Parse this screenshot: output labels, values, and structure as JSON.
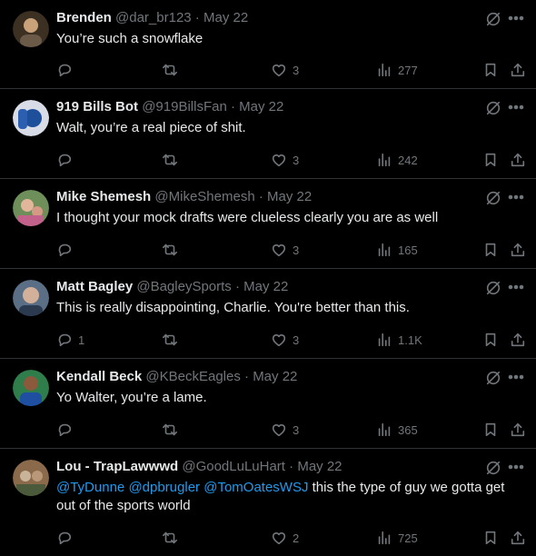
{
  "tweets": [
    {
      "name": "Brenden",
      "handle": "@dar_br123",
      "date": "May 22",
      "text": "You’re such a snowflake",
      "replies": "",
      "likes": "3",
      "views": "277",
      "avatar_colors": [
        "#3b3022",
        "#c9a27a"
      ]
    },
    {
      "name": "919 Bills Bot",
      "handle": "@919BillsFan",
      "date": "May 22",
      "text": "Walt, you’re a real piece of shit.",
      "replies": "",
      "likes": "3",
      "views": "242",
      "avatar_colors": [
        "#1d4f9a",
        "#d8dce6"
      ]
    },
    {
      "name": "Mike Shemesh",
      "handle": "@MikeShemesh",
      "date": "May 22",
      "text": "I thought your mock drafts  were clueless clearly you are as well",
      "replies": "",
      "likes": "3",
      "views": "165",
      "avatar_colors": [
        "#6f8f5a",
        "#e2b69a"
      ]
    },
    {
      "name": "Matt Bagley",
      "handle": "@BagleySports",
      "date": "May 22",
      "text": "This is really disappointing, Charlie. You're better than this.",
      "replies": "1",
      "likes": "3",
      "views": "1.1K",
      "avatar_colors": [
        "#5a6f86",
        "#d3b09a"
      ]
    },
    {
      "name": "Kendall Beck",
      "handle": "@KBeckEagles",
      "date": "May 22",
      "text": "Yo Walter, you’re a lame.",
      "replies": "",
      "likes": "3",
      "views": "365",
      "avatar_colors": [
        "#2e7d4a",
        "#8b5a3c"
      ]
    },
    {
      "name": "Lou - TrapLawwwd",
      "handle": "@GoodLuLuHart",
      "date": "May 22",
      "mentions": [
        "@TyDunne",
        "@dpbrugler",
        "@TomOatesWSJ"
      ],
      "text": "this the type of guy we gotta get out of the sports world",
      "replies": "",
      "likes": "2",
      "views": "725",
      "avatar_colors": [
        "#8a6a4a",
        "#c9b49a"
      ]
    }
  ],
  "separator": " · "
}
